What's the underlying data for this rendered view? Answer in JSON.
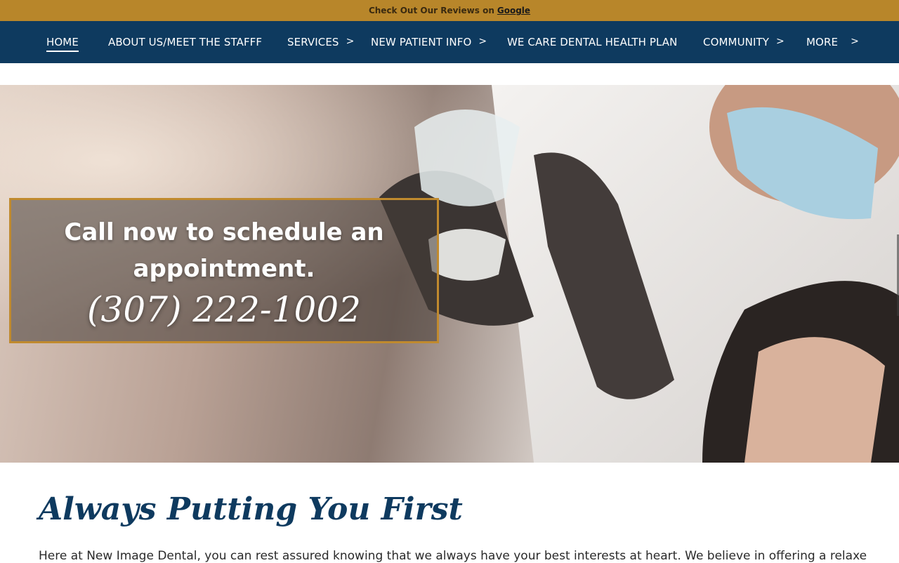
{
  "topbar": {
    "text": "Check Out Our Reviews on",
    "link": "Google"
  },
  "nav": {
    "items": [
      {
        "label": "HOME",
        "active": true
      },
      {
        "label": "ABOUT US/MEET THE STAFFF"
      },
      {
        "label": "SERVICES",
        "dropdown": true
      },
      {
        "label": "NEW PATIENT INFO",
        "dropdown": true
      },
      {
        "label": "WE CARE DENTAL HEALTH PLAN"
      },
      {
        "label": "COMMUNITY",
        "dropdown": true
      },
      {
        "label": "MORE",
        "dropdown": true
      }
    ],
    "chevron": ">"
  },
  "hero": {
    "cta_heading": "Call now to schedule an appointment.",
    "phone": "(307) 222-1002"
  },
  "main": {
    "title": "Always Putting You First",
    "intro": "Here at New Image Dental, you can rest assured knowing that we always have your best interests at heart. We believe in offering a relaxed"
  },
  "colors": {
    "topbar": "#b8862a",
    "nav": "#0e3a5f",
    "accent": "#c08a2e"
  }
}
